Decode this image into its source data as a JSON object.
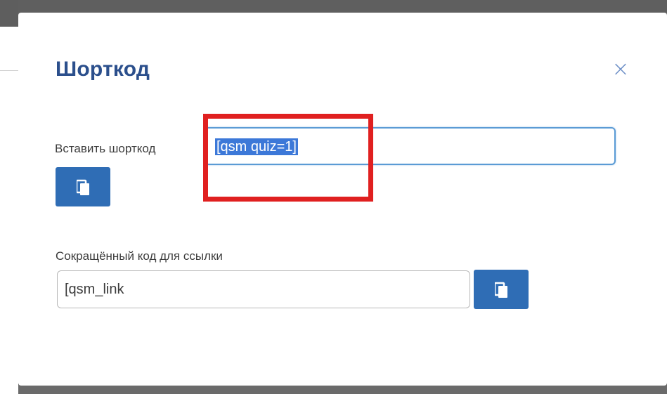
{
  "modal": {
    "title": "Шорткод",
    "close_symbol": "×",
    "shortcode_field": {
      "label": "Вставить шорткод",
      "value": "[qsm quiz=1]",
      "selected": true
    },
    "link_field": {
      "label": "Сокращённый код для ссылки",
      "value": "[qsm_link"
    },
    "copy_icon": "copy-icon"
  },
  "annotation": {
    "type": "red-highlight-box",
    "color": "#e02020"
  },
  "colors": {
    "title": "#2b4f8c",
    "button": "#2f6db5",
    "selection": "#3c78d8",
    "close": "#6d8fc7"
  }
}
